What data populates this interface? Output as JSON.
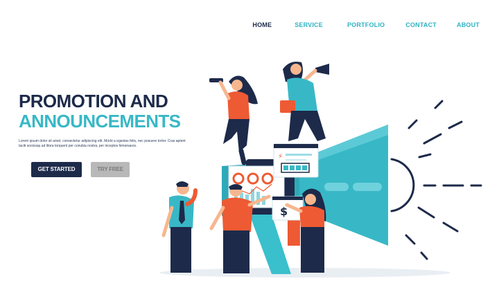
{
  "nav": {
    "items": [
      {
        "label": "HOME"
      },
      {
        "label": "SERVICE"
      },
      {
        "label": "PORTFOLIO"
      },
      {
        "label": "CONTACT"
      },
      {
        "label": "ABOUT"
      }
    ]
  },
  "hero": {
    "title_line1": "PROMOTION AND",
    "title_line2": "ANNOUNCEMENTS",
    "body": "Lorem ipsum dolor sit amet, consectetur adipiscing elit. Morbi a egestas felis, nec posuere tortor. Cras aptent taciti sociosqu ad litora torquent per conubia nostra, per inceptos himenaeos.",
    "cta_primary": "GET STARTED",
    "cta_secondary": "TRY FREE"
  },
  "colors": {
    "navy": "#1d2a4a",
    "teal": "#38b8c6",
    "orange": "#ee5a33",
    "grey_button": "#b8b8b8"
  },
  "illustration": {
    "icons": [
      "megaphone",
      "binoculars",
      "battery-indicator",
      "dollar-sign",
      "donut-chart",
      "bar-chart"
    ]
  }
}
